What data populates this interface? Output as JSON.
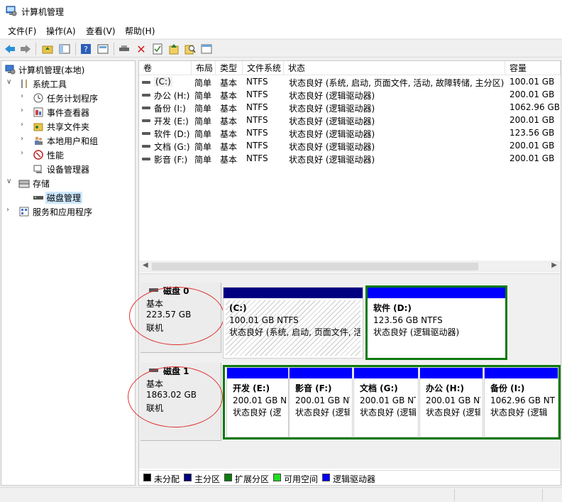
{
  "window": {
    "title": "计算机管理"
  },
  "menu": [
    "文件(F)",
    "操作(A)",
    "查看(V)",
    "帮助(H)"
  ],
  "toolbar": {
    "icons": [
      "back-icon",
      "forward-icon",
      "up-folder-icon",
      "show-hide-tree-icon",
      "help-icon",
      "properties-icon",
      "connect-icon",
      "delete-icon",
      "check-icon",
      "export-icon",
      "search-icon",
      "console-icon"
    ]
  },
  "tree": {
    "root": "计算机管理(本地)",
    "system_tools": "系统工具",
    "task_scheduler": "任务计划程序",
    "event_viewer": "事件查看器",
    "shared_folders": "共享文件夹",
    "local_users": "本地用户和组",
    "performance": "性能",
    "device_manager": "设备管理器",
    "storage": "存储",
    "disk_management": "磁盘管理",
    "services_apps": "服务和应用程序"
  },
  "volume_table": {
    "headers": [
      "卷",
      "布局",
      "类型",
      "文件系统",
      "状态",
      "容量"
    ],
    "rows": [
      [
        "(C:)",
        "简单",
        "基本",
        "NTFS",
        "状态良好 (系统, 启动, 页面文件, 活动, 故障转储, 主分区)",
        "100.01 GB"
      ],
      [
        "办公 (H:)",
        "简单",
        "基本",
        "NTFS",
        "状态良好 (逻辑驱动器)",
        "200.01 GB"
      ],
      [
        "备份 (I:)",
        "简单",
        "基本",
        "NTFS",
        "状态良好 (逻辑驱动器)",
        "1062.96 GB"
      ],
      [
        "开发 (E:)",
        "简单",
        "基本",
        "NTFS",
        "状态良好 (逻辑驱动器)",
        "200.01 GB"
      ],
      [
        "软件 (D:)",
        "简单",
        "基本",
        "NTFS",
        "状态良好 (逻辑驱动器)",
        "123.56 GB"
      ],
      [
        "文档 (G:)",
        "简单",
        "基本",
        "NTFS",
        "状态良好 (逻辑驱动器)",
        "200.01 GB"
      ],
      [
        "影音 (F:)",
        "简单",
        "基本",
        "NTFS",
        "状态良好 (逻辑驱动器)",
        "200.01 GB"
      ]
    ]
  },
  "disks": [
    {
      "name": "磁盘 0",
      "type": "基本",
      "size": "223.57 GB",
      "status": "联机",
      "partitions": [
        {
          "name": "(C:)",
          "size": "100.01 GB NTFS",
          "status": "状态良好 (系统, 启动, 页面文件, 活",
          "bar_color": "#000080",
          "frame_color": "#cfcfcf"
        },
        {
          "name": "软件   (D:)",
          "size": "123.56 GB NTFS",
          "status": "状态良好 (逻辑驱动器)",
          "bar_color": "#0000ff",
          "frame_color": "#0c7a0c"
        }
      ]
    },
    {
      "name": "磁盘 1",
      "type": "基本",
      "size": "1863.02 GB",
      "status": "联机",
      "partitions": [
        {
          "name": "开发   (E:)",
          "size": "200.01 GB N",
          "status": "状态良好 (逻",
          "bar_color": "#0000ff"
        },
        {
          "name": "影音   (F:)",
          "size": "200.01 GB NT",
          "status": "状态良好 (逻辑",
          "bar_color": "#0000ff"
        },
        {
          "name": "文档   (G:)",
          "size": "200.01 GB NT",
          "status": "状态良好 (逻辑",
          "bar_color": "#0000ff"
        },
        {
          "name": "办公   (H:)",
          "size": "200.01 GB NT",
          "status": "状态良好 (逻辑",
          "bar_color": "#0000ff"
        },
        {
          "name": "备份   (I:)",
          "size": "1062.96 GB NT",
          "status": "状态良好 (逻辑",
          "bar_color": "#0000ff"
        }
      ]
    }
  ],
  "legend": [
    {
      "label": "未分配",
      "color": "#000000"
    },
    {
      "label": "主分区",
      "color": "#000080"
    },
    {
      "label": "扩展分区",
      "color": "#0c7a0c"
    },
    {
      "label": "可用空间",
      "color": "#22dd22"
    },
    {
      "label": "逻辑驱动器",
      "color": "#0000ff"
    }
  ],
  "colors": {
    "selection": "#cce8ff",
    "annotation_circle": "#e03030"
  }
}
